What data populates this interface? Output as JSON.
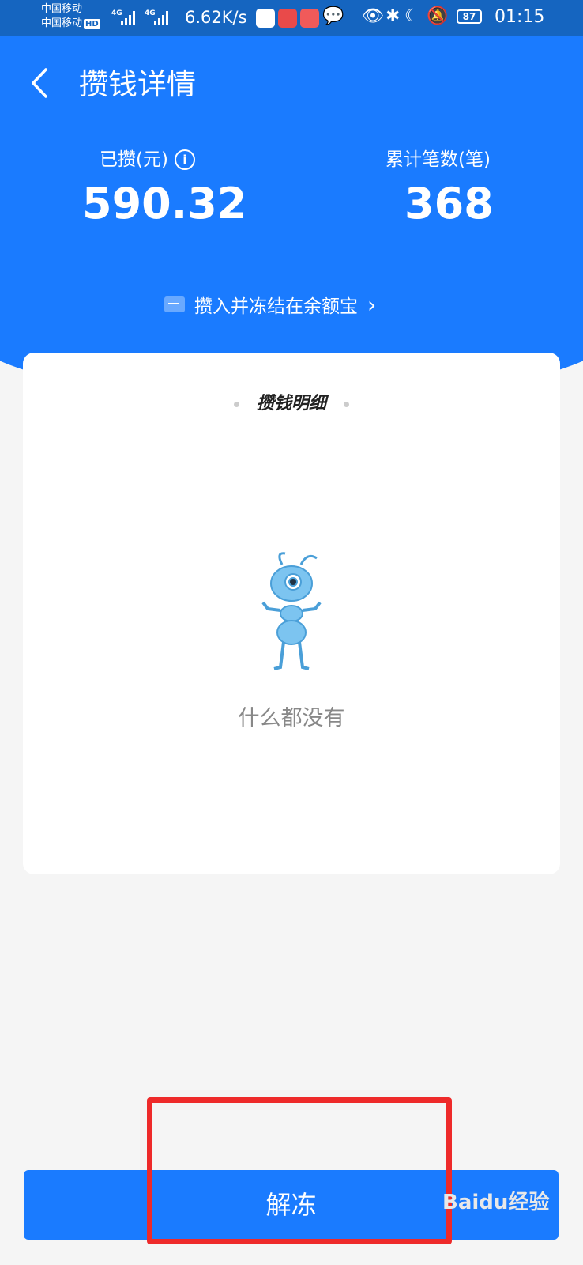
{
  "status_bar": {
    "carrier1": "中国移动",
    "carrier2": "中国移动",
    "hd_badge": "HD",
    "net1": "4G",
    "net2": "4G",
    "speed": "6.62K/s",
    "battery": "87",
    "time": "01:15"
  },
  "header": {
    "title": "攒钱详情"
  },
  "stats": {
    "saved_label": "已攒(元)",
    "saved_value": "590.32",
    "count_label": "累计笔数(笔)",
    "count_value": "368"
  },
  "freeze_link": {
    "label": "攒入并冻结在余额宝"
  },
  "details": {
    "title": "攒钱明细",
    "empty_text": "什么都没有"
  },
  "actions": {
    "unfreeze_label": "解冻"
  },
  "watermark": {
    "text": "Baidu经验"
  },
  "colors": {
    "primary": "#1a7bff",
    "status_bar": "#1565c0",
    "highlight": "#ee2a2a"
  }
}
